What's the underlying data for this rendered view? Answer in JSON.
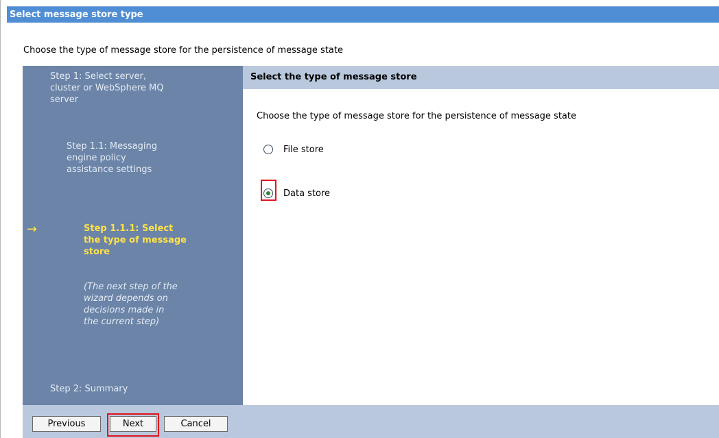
{
  "window": {
    "title": "Select message store type"
  },
  "page": {
    "description": "Choose the type of message store for the persistence of message state"
  },
  "wizard": {
    "steps": [
      "Step  1: Select server, cluster or WebSphere MQ server",
      "Step  1.1: Messaging engine policy assistance settings",
      "Step  1.1.1: Select the type of message store",
      "(The next step of the wizard depends on decisions made in the current step)",
      "Step  2: Summary"
    ]
  },
  "panel": {
    "header": "Select the type of message store",
    "description": "Choose the type of message store for the persistence of message state",
    "options": [
      {
        "label": "File store",
        "selected": false
      },
      {
        "label": "Data store",
        "selected": true
      }
    ]
  },
  "buttons": {
    "previous": "Previous",
    "next": "Next",
    "cancel": "Cancel"
  },
  "colors": {
    "title_bar": "#4f8ed4",
    "wizard_nav": "#6b84a8",
    "current_step": "#ffe14a",
    "panel_header": "#b9c8dd",
    "highlight": "#e0141c"
  }
}
